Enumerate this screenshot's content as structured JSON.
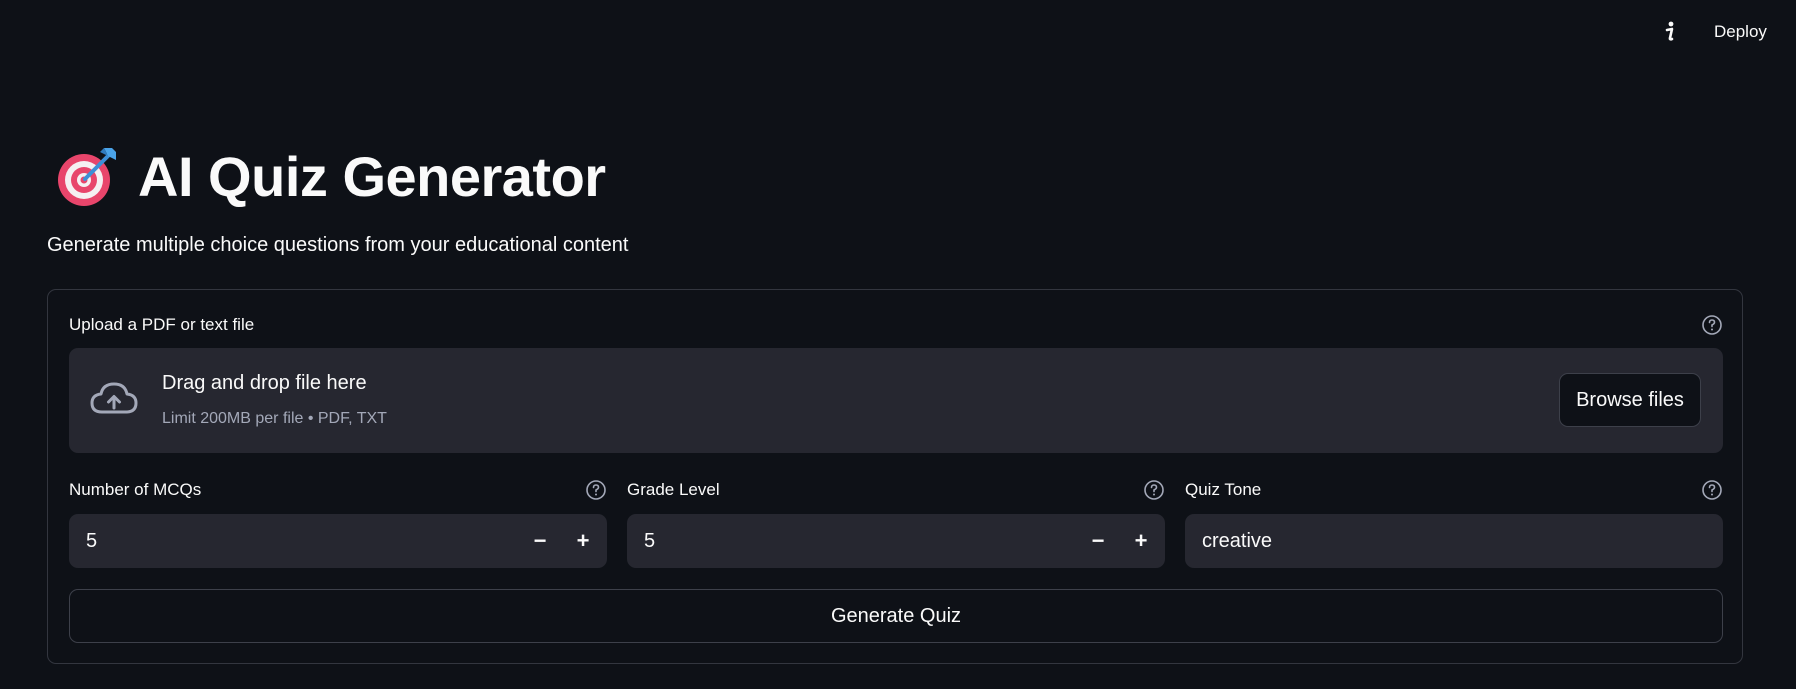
{
  "header": {
    "info_icon": "info-icon",
    "deploy_label": "Deploy"
  },
  "page": {
    "title": "AI Quiz Generator",
    "title_icon": "target-dart-emoji",
    "subtitle": "Generate multiple choice questions from your educational content"
  },
  "uploader": {
    "label": "Upload a PDF or text file",
    "dropzone_title": "Drag and drop file here",
    "dropzone_limit": "Limit 200MB per file • PDF, TXT",
    "browse_label": "Browse files",
    "icon": "cloud-upload-icon"
  },
  "fields": {
    "mcq_count": {
      "label": "Number of MCQs",
      "value": "5",
      "minus": "−",
      "plus": "+"
    },
    "grade_level": {
      "label": "Grade Level",
      "value": "5",
      "minus": "−",
      "plus": "+"
    },
    "quiz_tone": {
      "label": "Quiz Tone",
      "value": "creative"
    }
  },
  "actions": {
    "generate_label": "Generate Quiz"
  },
  "colors": {
    "background": "#0e1117",
    "input_bg": "#262730",
    "border": "#33363f",
    "text": "#fafafa",
    "muted_text": "#a3a8b8"
  }
}
